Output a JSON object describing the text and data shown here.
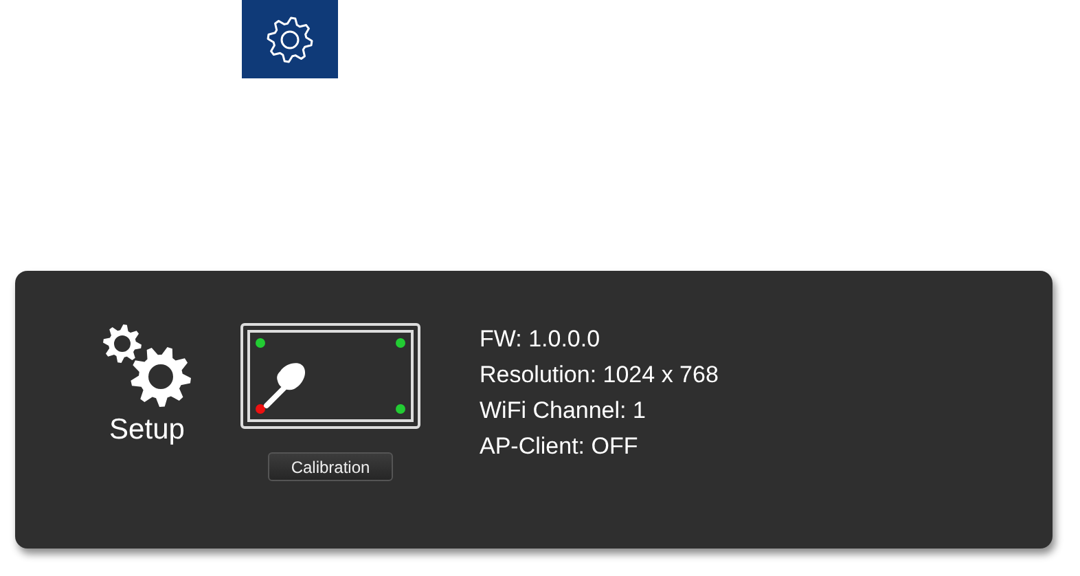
{
  "settings_tile": {
    "kind": "gear"
  },
  "panel": {
    "title": "Setup",
    "calibration": {
      "points": [
        {
          "color": "#22cc33"
        },
        {
          "color": "#22cc33"
        },
        {
          "color": "#ee1111"
        },
        {
          "color": "#22cc33"
        }
      ],
      "button": "Calibration"
    },
    "info": [
      "FW: 1.0.0.0",
      "Resolution: 1024 x 768",
      "WiFi Channel: 1",
      "AP-Client: OFF"
    ]
  }
}
